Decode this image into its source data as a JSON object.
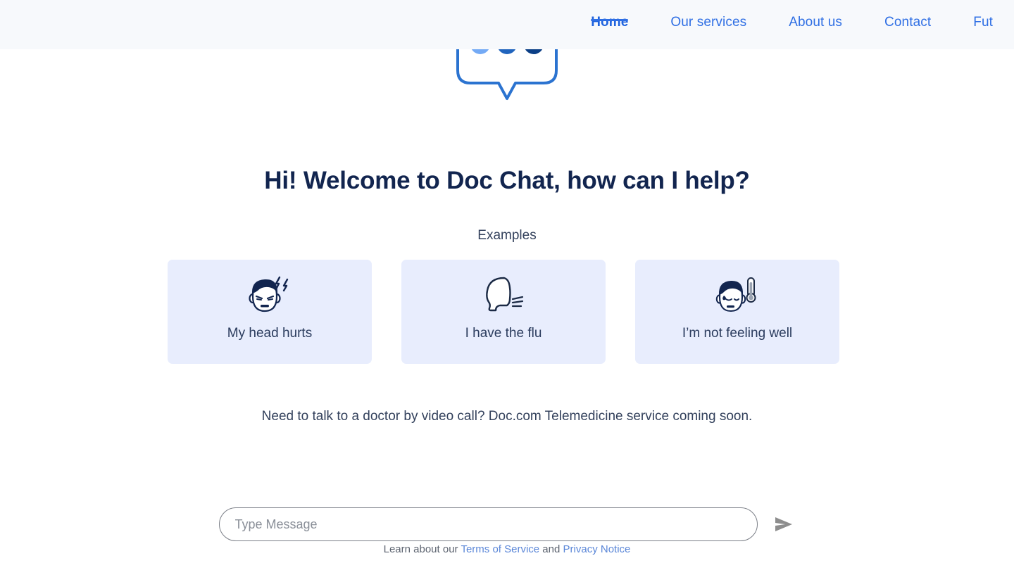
{
  "header": {
    "background_color": "#f7f9fc",
    "nav_items": [
      {
        "label": "Home",
        "active": true
      },
      {
        "label": "Our services",
        "active": false
      },
      {
        "label": "About us",
        "active": false
      },
      {
        "label": "Contact",
        "active": false
      },
      {
        "label": "Fut",
        "active": false
      }
    ],
    "accent_color": "#2f6fe4"
  },
  "logo": {
    "name": "chat-bubble-logo",
    "outline_color": "#2b73d0",
    "dots": [
      {
        "name": "dot-light",
        "color": "#74aaf5"
      },
      {
        "name": "dot-medium",
        "color": "#2064bd"
      },
      {
        "name": "dot-dark",
        "color": "#0b3f86"
      }
    ]
  },
  "main": {
    "title": "Hi! Welcome to Doc Chat, how can I help?",
    "title_color": "#12254f",
    "examples_label": "Examples",
    "cards": [
      {
        "label": "My head hurts",
        "icon": "headache-face-icon"
      },
      {
        "label": "I have the flu",
        "icon": "coughing-head-icon"
      },
      {
        "label": "I’m not feeling well",
        "icon": "fever-face-thermometer-icon"
      }
    ],
    "card_background": "#e8edfd",
    "telemedicine_note": "Need to talk to a doctor by video call? Doc.com Telemedicine service coming soon."
  },
  "composer": {
    "placeholder": "Type Message",
    "value": "",
    "send_icon": "send-arrow-icon",
    "send_icon_color": "#8d8d8d"
  },
  "footer": {
    "prefix": "Learn about our ",
    "terms_link": "Terms of Service",
    "conjunction": " and ",
    "privacy_link": "Privacy Notice",
    "link_color": "#5b87d8"
  }
}
